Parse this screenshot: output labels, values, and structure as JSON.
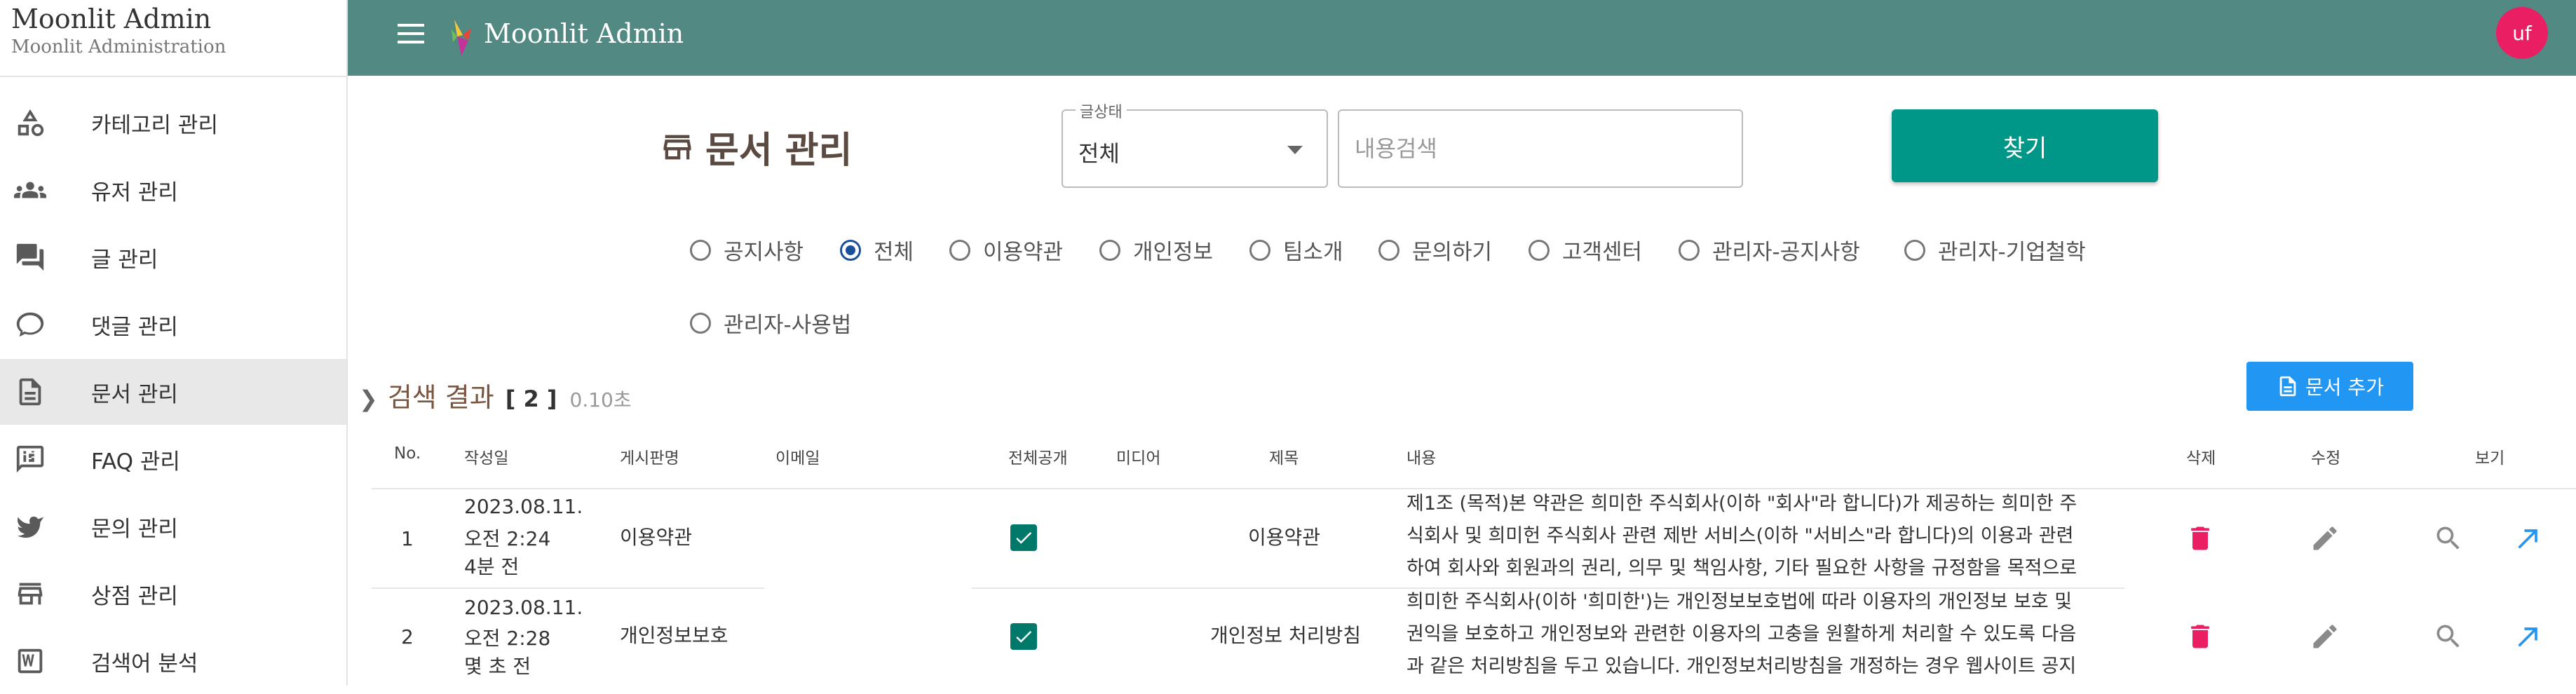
{
  "app": {
    "title": "Moonlit Admin",
    "subtitle": "Moonlit Administration",
    "brand": "Moonlit Admin",
    "avatar_initials": "uf"
  },
  "sidebar": {
    "items": [
      {
        "label": "카테고리 관리",
        "icon": "category-shapes-icon"
      },
      {
        "label": "유저 관리",
        "icon": "people-icon"
      },
      {
        "label": "글 관리",
        "icon": "forum-icon"
      },
      {
        "label": "댓글 관리",
        "icon": "chat-bubble-icon"
      },
      {
        "label": "문서 관리",
        "icon": "document-icon",
        "active": true
      },
      {
        "label": "FAQ 관리",
        "icon": "faq-icon"
      },
      {
        "label": "문의 관리",
        "icon": "bird-icon"
      },
      {
        "label": "상점 관리",
        "icon": "store-icon"
      },
      {
        "label": "검색어 분석",
        "icon": "search-analysis-icon"
      }
    ]
  },
  "main": {
    "title": "문서 관리",
    "filter": {
      "legend": "글상태",
      "value": "전체",
      "search_placeholder": "내용검색",
      "search_button": "찾기"
    },
    "radios": [
      {
        "label": "공지사항",
        "checked": false
      },
      {
        "label": "전체",
        "checked": true
      },
      {
        "label": "이용약관",
        "checked": false
      },
      {
        "label": "개인정보",
        "checked": false
      },
      {
        "label": "팀소개",
        "checked": false
      },
      {
        "label": "문의하기",
        "checked": false
      },
      {
        "label": "고객센터",
        "checked": false
      },
      {
        "label": "관리자-공지사항",
        "checked": false
      },
      {
        "label": "관리자-기업철학",
        "checked": false
      },
      {
        "label": "관리자-사용법",
        "checked": false
      }
    ],
    "results": {
      "label": "검색 결과",
      "count": "[ 2 ]",
      "time": "0.10초",
      "add_button": "문서 추가"
    },
    "table": {
      "headers": [
        "No.",
        "작성일",
        "게시판명",
        "이메일",
        "전체공개",
        "미디어",
        "제목",
        "내용",
        "삭제",
        "수정",
        "보기"
      ],
      "rows": [
        {
          "no": "1",
          "date": [
            "2023.08.11.",
            "오전 2:24",
            "4분 전"
          ],
          "board": "이용약관",
          "email": "",
          "public": true,
          "media": "",
          "title": "이용약관",
          "content": [
            "제1조 (목적)본 약관은 희미한 주식회사(이하 \"회사\"라 합니다)가 제공하는 희미한 주",
            "식회사 및 희미헌 주식회사 관련 제반 서비스(이하 \"서비스\"라 합니다)의 이용과 관련",
            "하여 회사와 회원과의 권리, 의무 및 책임사항, 기타 필요한 사항을 규정함을 목적으로"
          ]
        },
        {
          "no": "2",
          "date": [
            "2023.08.11.",
            "오전 2:28",
            "몇 초 전"
          ],
          "board": "개인정보보호",
          "email": "",
          "public": true,
          "media": "",
          "title": "개인정보 처리방침",
          "content": [
            "희미한 주식회사(이하 '희미한')는 개인정보보호법에 따라 이용자의 개인정보 보호 및",
            "권익을 보호하고 개인정보와 관련한 이용자의 고충을 원활하게 처리할 수 있도록 다음",
            "과 같은 처리방침을 두고 있습니다. 개인정보처리방침을 개정하는 경우 웹사이트 공지"
          ]
        }
      ]
    }
  },
  "colors": {
    "topbar": "#528a83",
    "primary_button": "#009688",
    "add_button": "#2196f3",
    "avatar": "#e91e63",
    "delete_icon": "#e91e63",
    "view_link_icon": "#2196f3",
    "checkbox": "#00796b"
  }
}
